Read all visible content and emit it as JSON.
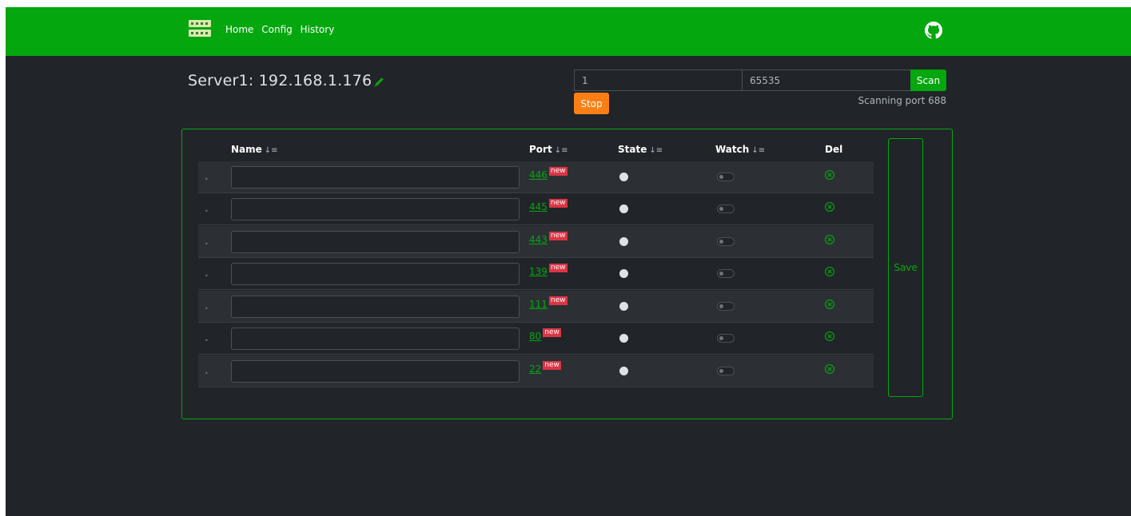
{
  "nav": {
    "links": [
      "Home",
      "Config",
      "History"
    ],
    "logo_icon": "network-switch-icon",
    "github_icon": "github-icon"
  },
  "server": {
    "title": "Server1: 192.168.1.176",
    "edit_icon": "pencil-icon"
  },
  "scan": {
    "from_value": "1",
    "to_value": "65535",
    "scan_label": "Scan",
    "stop_label": "Stop",
    "status": "Scanning port 688"
  },
  "table": {
    "headers": {
      "name": "Name",
      "port": "Port",
      "state": "State",
      "watch": "Watch",
      "del": "Del"
    },
    "sort_glyph": "↓≡",
    "rows": [
      {
        "port": "446",
        "badge": "new",
        "name": ""
      },
      {
        "port": "445",
        "badge": "new",
        "name": ""
      },
      {
        "port": "443",
        "badge": "new",
        "name": ""
      },
      {
        "port": "139",
        "badge": "new",
        "name": ""
      },
      {
        "port": "111",
        "badge": "new",
        "name": ""
      },
      {
        "port": "80",
        "badge": "new",
        "name": ""
      },
      {
        "port": "22",
        "badge": "new",
        "name": ""
      }
    ]
  },
  "save_label": "Save",
  "colors": {
    "accent": "#04a70e",
    "background": "#212529",
    "stop": "#fd7e14",
    "badge": "#dc3545"
  }
}
